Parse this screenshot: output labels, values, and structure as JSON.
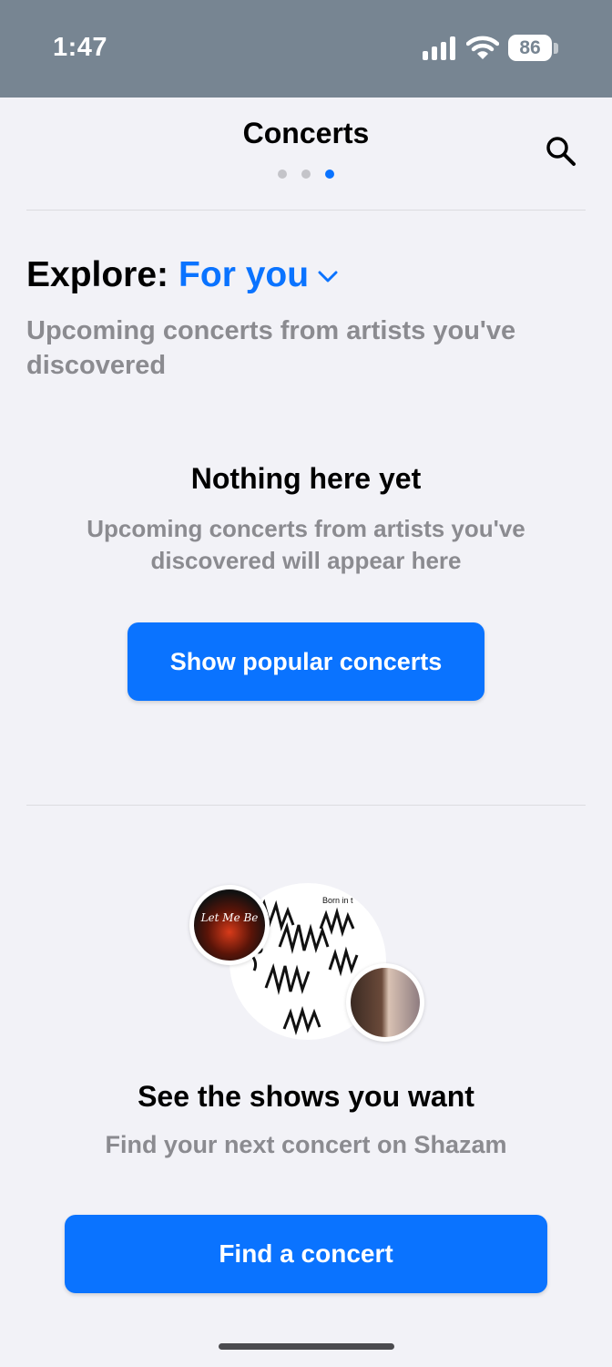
{
  "status_bar": {
    "time": "1:47",
    "battery": "86"
  },
  "header": {
    "title": "Concerts",
    "page_count": 3,
    "active_page": 3
  },
  "explore": {
    "label": "Explore:",
    "filter": "For you",
    "subtitle": "Upcoming concerts from artists you've discovered"
  },
  "empty_state": {
    "title": "Nothing here yet",
    "description": "Upcoming concerts from artists you've discovered will appear here",
    "button_label": "Show popular concerts"
  },
  "promo": {
    "art_left_text": "Let Me Be",
    "art_main_text": "Born in t",
    "title": "See the shows you want",
    "description": "Find your next concert on Shazam",
    "button_label": "Find a concert"
  },
  "colors": {
    "accent": "#0a73ff",
    "status_bar": "#778592",
    "background": "#f2f2f7"
  }
}
